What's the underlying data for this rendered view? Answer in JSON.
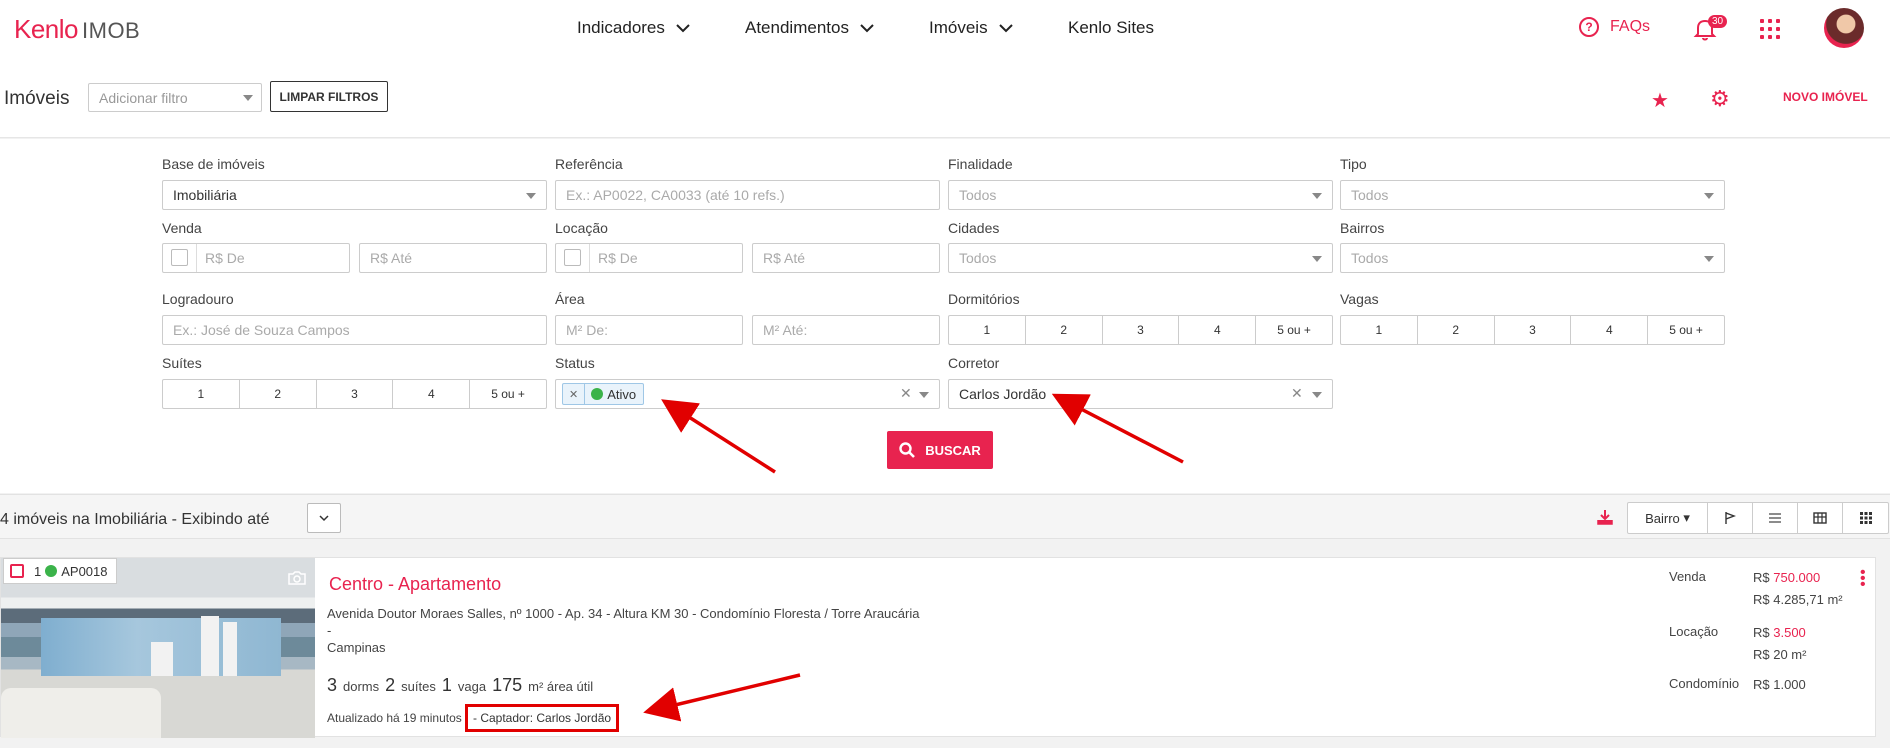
{
  "header": {
    "logo_brand": "Kenlo",
    "logo_product": "IMOB",
    "nav": [
      {
        "label": "Indicadores"
      },
      {
        "label": "Atendimentos"
      },
      {
        "label": "Imóveis"
      },
      {
        "label": "Kenlo Sites"
      }
    ],
    "faq_label": "FAQs",
    "notifications_count": "30"
  },
  "subheader": {
    "title": "Imóveis",
    "filter_placeholder": "Adicionar filtro",
    "clear_filters": "LIMPAR FILTROS",
    "new_property": "NOVO IMÓVEL"
  },
  "filters": {
    "base_label": "Base de imóveis",
    "base_value": "Imobiliária",
    "referencia_label": "Referência",
    "referencia_placeholder": "Ex.: AP0022, CA0033 (até 10 refs.)",
    "finalidade_label": "Finalidade",
    "finalidade_value": "Todos",
    "tipo_label": "Tipo",
    "tipo_value": "Todos",
    "venda_label": "Venda",
    "venda_from": "R$ De",
    "venda_to": "R$ Até",
    "locacao_label": "Locação",
    "locacao_from": "R$ De",
    "locacao_to": "R$ Até",
    "cidades_label": "Cidades",
    "cidades_value": "Todos",
    "bairros_label": "Bairros",
    "bairros_value": "Todos",
    "logradouro_label": "Logradouro",
    "logradouro_placeholder": "Ex.: José de Souza Campos",
    "area_label": "Área",
    "area_from": "M² De:",
    "area_to": "M² Até:",
    "dormitorios_label": "Dormitórios",
    "vagas_label": "Vagas",
    "suites_label": "Suítes",
    "count_options": [
      "1",
      "2",
      "3",
      "4",
      "5 ou +"
    ],
    "status_label": "Status",
    "status_tag": "Ativo",
    "corretor_label": "Corretor",
    "corretor_value": "Carlos Jordão",
    "search_button": "BUSCAR"
  },
  "results": {
    "count_text": "4 imóveis na Imobiliária - Exibindo até",
    "sort_label": "Bairro"
  },
  "listing": {
    "index": "1",
    "ref": "AP0018",
    "title": "Centro - Apartamento",
    "address_line1": "Avenida Doutor Moraes Salles, nº 1000 - Ap. 34 - Altura KM 30 - Condomínio Floresta / Torre Araucária -",
    "address_line2": "Campinas",
    "dorms_num": "3",
    "dorms_txt": "dorms",
    "suites_num": "2",
    "suites_txt": "suítes",
    "vaga_num": "1",
    "vaga_txt": "vaga",
    "area_num": "175",
    "area_txt": "m² área útil",
    "updated": "Atualizado há 19 minutos",
    "captador": "- Captador: Carlos Jordão",
    "venda_label": "Venda",
    "venda_prefix": "R$",
    "venda_value": "750.000",
    "venda_m2": "R$ 4.285,71 m²",
    "locacao_label": "Locação",
    "locacao_prefix": "R$",
    "locacao_value": "3.500",
    "locacao_m2": "R$ 20 m²",
    "condominio_label": "Condomínio",
    "condominio_value": "R$ 1.000"
  },
  "colors": {
    "brand": "#e8234f",
    "status_active": "#3bb34a",
    "annotation": "#e10000"
  }
}
